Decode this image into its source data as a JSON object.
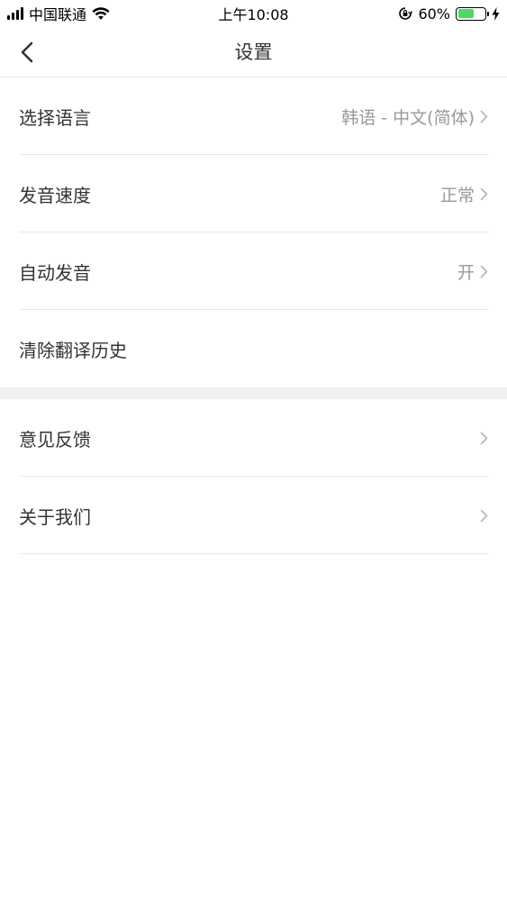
{
  "status_bar": {
    "carrier": "中国联通",
    "time": "上午10:08",
    "battery_percent": "60%",
    "battery_level": 0.6,
    "icons": [
      "signal-icon",
      "wifi-icon",
      "rotation-lock-icon",
      "battery-icon",
      "charging-icon"
    ]
  },
  "nav": {
    "title": "设置",
    "back_icon": "chevron-left-icon"
  },
  "settings": {
    "items": [
      {
        "label": "选择语言",
        "value": "韩语 - 中文(简体)"
      },
      {
        "label": "发音速度",
        "value": "正常"
      },
      {
        "label": "自动发音",
        "value": "开"
      },
      {
        "label": "清除翻译历史",
        "value": ""
      }
    ]
  },
  "misc": {
    "items": [
      {
        "label": "意见反馈"
      },
      {
        "label": "关于我们"
      }
    ]
  },
  "colors": {
    "accent_battery": "#4cd964",
    "text_primary": "#333333",
    "text_secondary": "#999999",
    "divider": "#e6e6e6",
    "section_gap": "#f0f0f2"
  }
}
